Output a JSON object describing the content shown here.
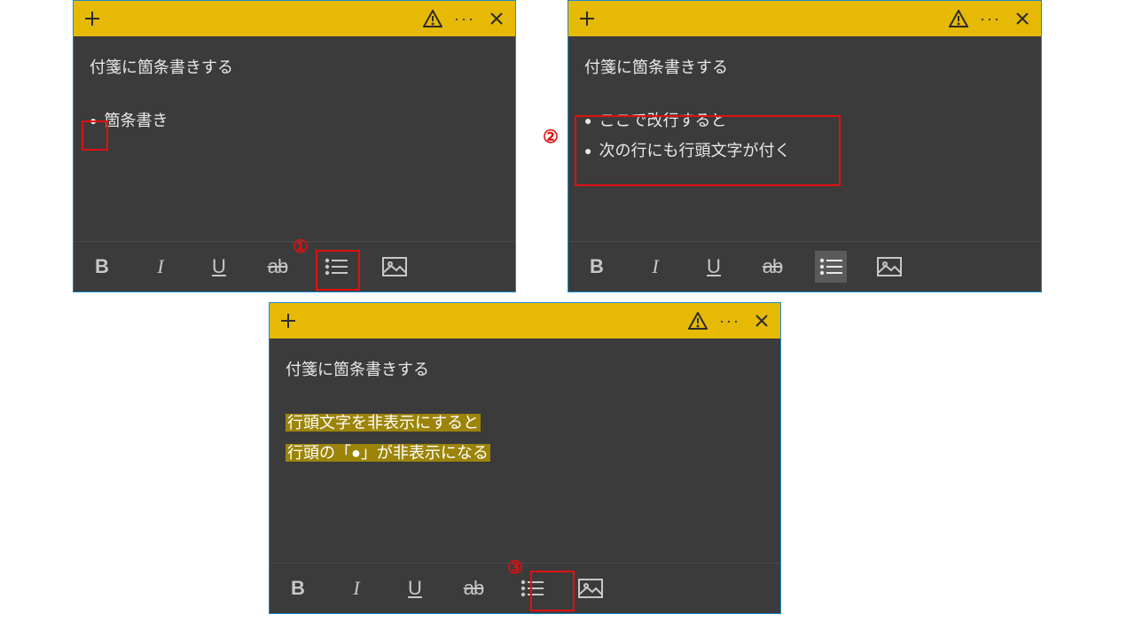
{
  "colors": {
    "titlebar": "#e6b905",
    "note_bg": "#3b3b3b",
    "text": "#e8e8e8",
    "annotation": "#e11010"
  },
  "toolbar_buttons": {
    "bold": "B",
    "italic": "I",
    "underline": "U",
    "strike": "ab",
    "bullets_name": "bullet-list",
    "image_name": "insert-image"
  },
  "annotations": {
    "step1": "①",
    "step2": "②",
    "step3": "③"
  },
  "notes": [
    {
      "id": "note1",
      "title": "付箋に箇条書きする",
      "lines": [
        {
          "bullet": true,
          "text": "箇条書き"
        }
      ],
      "highlight": false,
      "bullets_active": false
    },
    {
      "id": "note2",
      "title": "付箋に箇条書きする",
      "lines": [
        {
          "bullet": true,
          "text": "ここで改行すると"
        },
        {
          "bullet": true,
          "text": "次の行にも行頭文字が付く"
        }
      ],
      "highlight": false,
      "bullets_active": true
    },
    {
      "id": "note3",
      "title": "付箋に箇条書きする",
      "lines": [
        {
          "bullet": false,
          "text": "行頭文字を非表示にすると"
        },
        {
          "bullet": false,
          "text": "行頭の「●」が非表示になる"
        }
      ],
      "highlight": true,
      "bullets_active": false
    }
  ]
}
